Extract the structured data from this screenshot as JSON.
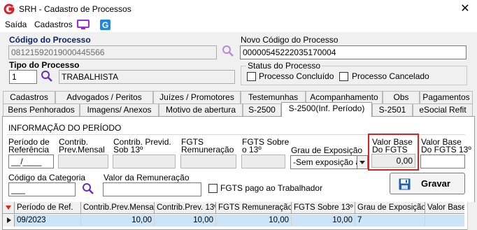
{
  "window": {
    "title": "SRH - Cadastro de Processos",
    "close": "✕"
  },
  "menu": {
    "items": [
      "Saída",
      "Cadastros"
    ],
    "icons": [
      "monitor-icon",
      "app-g-icon"
    ]
  },
  "form": {
    "codigo_label": "Código do Processo",
    "codigo_value": "08121592019000445566",
    "novo_codigo_label": "Novo Código do Processo",
    "novo_codigo_value": "00000545222035170004",
    "tipo_label": "Tipo do Processo",
    "tipo_code": "1",
    "tipo_desc": "TRABALHISTA",
    "status_label": "Status do Processo",
    "status_concluido": "Processo Concluído",
    "status_cancelado": "Processo Cancelado"
  },
  "tabs": {
    "row1": [
      "Cadastros",
      "Advogados / Peritos",
      "Juízes / Promotores",
      "Testemunhas",
      "Acompanhamento",
      "Obs",
      "Pagamentos"
    ],
    "row2": [
      "Bens Penhorados",
      "Imagens/ Anexos",
      "Motivo de abertura",
      "S-2500",
      "S-2500(Inf. Período)",
      "S-2501",
      "eSocial Refit"
    ],
    "active": "S-2500(Inf. Período)"
  },
  "panel": {
    "section_title": "INFORMAÇÃO DO PERÍODO",
    "periodo_label_1": "Período de",
    "periodo_label_2": "Referência",
    "periodo_value": "__/____",
    "contrib_mensal_1": "Contrib.",
    "contrib_mensal_2": "Prev.Mensal",
    "contrib_13_1": "Contrib. Previd.",
    "contrib_13_2": "Sob 13º",
    "fgts_rem_1": "FGTS",
    "fgts_rem_2": "Remuneração",
    "fgts_13_1": "FGTS Sobre",
    "fgts_13_2": "o 13º",
    "grau_label": "Grau de Exposição",
    "grau_value": "-Sem exposição a",
    "valor_base_1": "Valor Base",
    "valor_base_2": "Do FGTS",
    "valor_base_value": "0,00",
    "valor_base13_1": "Valor Base",
    "valor_base13_2": "Do FGTS 13º",
    "categoria_label": "Código da Categoria",
    "categoria_value": "___",
    "remuneracao_label": "Valor da Remuneração",
    "fgts_pago_label": "FGTS pago ao Trabalhador",
    "gravar_label": "Gravar"
  },
  "grid": {
    "headers": [
      "Período de Ref.",
      "Contrib.Prev.Mensal",
      "Contrib.Prev. 13º",
      "FGTS Remuneração",
      "FGTS Sobre 13º",
      "Grau de Exposição",
      "Valor Base"
    ],
    "rows": [
      [
        "09/2023",
        "10,00",
        "10,00",
        "10,00",
        "10,00",
        "7",
        ""
      ]
    ]
  },
  "colors": {
    "highlight": "#d9231d",
    "selected_row": "#cce4f7",
    "link_blue": "#0a246a",
    "search_icon": "#6a2bbf"
  }
}
